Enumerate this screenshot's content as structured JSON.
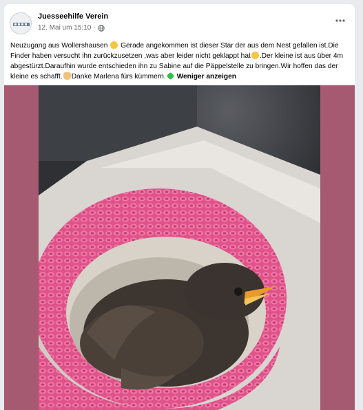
{
  "post": {
    "author": "Juesseehilfe Verein",
    "date": "12. Mai um 15:10",
    "date_separator": "·",
    "text_part1": "Neuzugang aus Wollershausen",
    "text_part2": " Gerade angekommen ist dieser Star der aus dem Nest gefallen ist.Die Finder haben versucht ihn zurückzusetzen ,was aber leider nicht geklappt hat",
    "text_part3": ".Der kleine ist aus über 4m abgestürzt.Daraufhin wurde entschieden ihn zu Sabine auf die Päppelstelle zu bringen.Wir hoffen das der kleine es schafft.",
    "text_part4": "Danke Marlena fürs kümmern.",
    "show_less": "Weniger anzeigen"
  },
  "colors": {
    "media_background": "#a65a72",
    "crochet_nest": "#e0528a",
    "beak": "#e89a2a"
  },
  "icons": {
    "more": "more-options-icon",
    "privacy": "globe-icon"
  }
}
